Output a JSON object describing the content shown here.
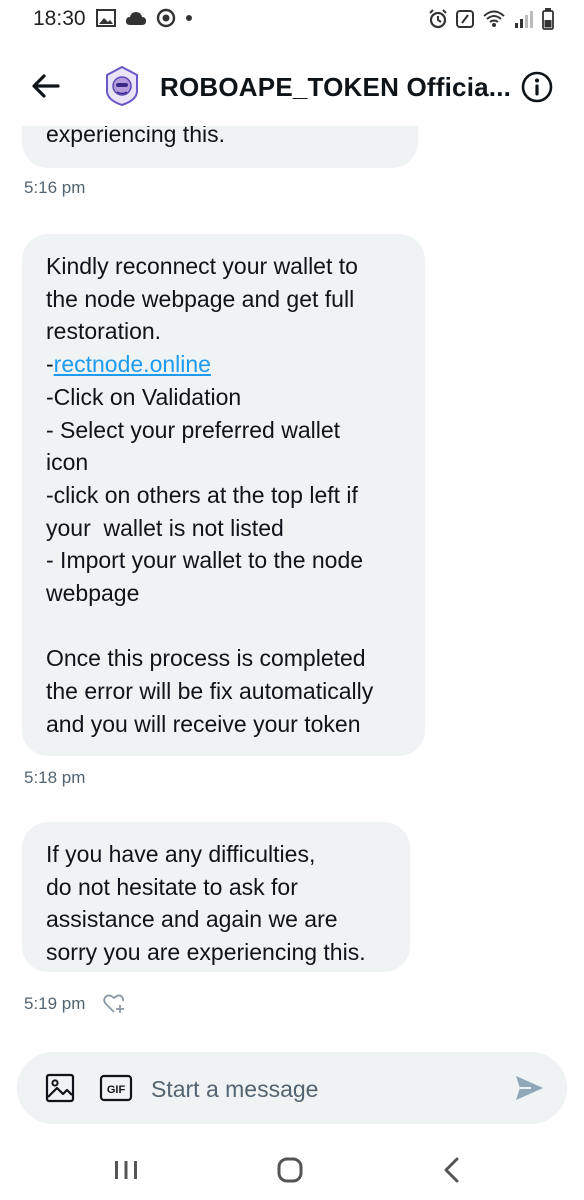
{
  "status_bar": {
    "time": "18:30",
    "left_icons": [
      "gallery-icon",
      "cloud-icon",
      "chrome-icon",
      "dot-icon"
    ],
    "right_icons": [
      "alarm-icon",
      "nfc-icon",
      "wifi-icon",
      "signal-icon",
      "battery-icon"
    ]
  },
  "header": {
    "title": "ROBOAPE_TOKEN Officia..."
  },
  "messages": [
    {
      "lines": [
        "experiencing this."
      ],
      "time": "5:16 pm"
    },
    {
      "lines": [
        "Kindly reconnect your wallet to",
        "the node webpage and get full",
        "restoration.",
        "-",
        "-Click on Validation",
        "- Select your preferred wallet",
        "icon",
        "-click on others at the top left if",
        "your  wallet is not listed",
        "- Import your wallet to the node",
        "webpage",
        " ",
        "Once this process is completed",
        "the error will be fix automatically",
        "and you will receive your token"
      ],
      "link": "rectnode.online",
      "time": "5:18 pm"
    },
    {
      "lines": [
        "If you have any difficulties,",
        "do not hesitate to ask for",
        "assistance and again we are",
        "sorry you are experiencing this."
      ],
      "time": "5:19 pm"
    }
  ],
  "composer": {
    "placeholder": "Start a message",
    "gif_label": "GIF"
  },
  "colors": {
    "bubble_bg": "#eff3f4",
    "link": "#1d9bf0",
    "muted": "#536471",
    "send": "#8ea6b5"
  }
}
